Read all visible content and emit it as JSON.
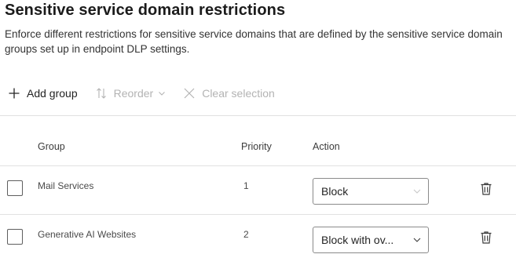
{
  "header": {
    "title": "Sensitive service domain restrictions",
    "description": "Enforce different restrictions for sensitive service domains that are defined by the sensitive service domain groups set up in endpoint DLP settings."
  },
  "toolbar": {
    "add_group_label": "Add group",
    "reorder_label": "Reorder",
    "clear_selection_label": "Clear selection"
  },
  "table": {
    "columns": [
      "Group",
      "Priority",
      "Action"
    ],
    "rows": [
      {
        "group": "Mail Services",
        "priority": "1",
        "action": "Block"
      },
      {
        "group": "Generative AI Websites",
        "priority": "2",
        "action": "Block with ov..."
      }
    ]
  },
  "colors": {
    "text": "#242424",
    "disabled": "#b3b3b3",
    "divider": "#e1e1e1",
    "border": "#8a8a8a"
  },
  "icons": [
    "add-icon",
    "reorder-icon",
    "chevron-down-icon",
    "close-icon",
    "trash-icon"
  ]
}
